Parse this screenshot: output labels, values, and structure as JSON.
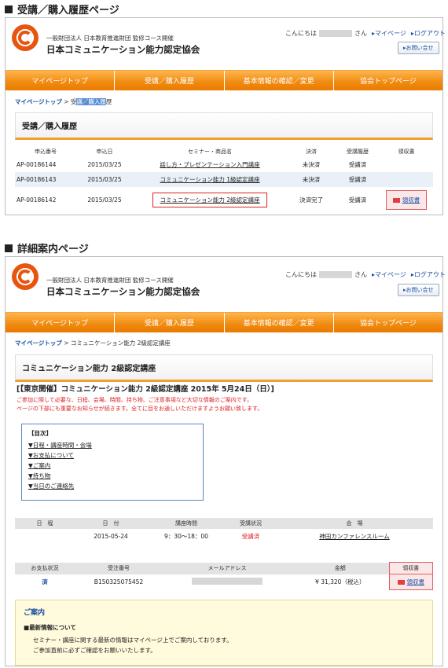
{
  "section1_title": "受講／購入履歴ページ",
  "section2_title": "詳細案内ページ",
  "header": {
    "org_small": "一般財団法人 日本教育推進財団 監修コース開催",
    "org_large": "日本コミュニケーション能力認定協会",
    "greeting_pre": "こんにちは",
    "greeting_post": "さん",
    "mypage_link": "▸マイページ",
    "logout_link": "▸ログアウト",
    "inquiry_button": "▸お問い合せ"
  },
  "nav": [
    "マイページトップ",
    "受講／購入履歴",
    "基本情報の確認／変更",
    "協会トップページ"
  ],
  "page1": {
    "crumb_home": "マイページトップ",
    "crumb_sep": " > ",
    "crumb_cur_a": "受",
    "crumb_cur_b": "講／購入履",
    "crumb_cur_c": "歴",
    "title": "受講／購入履歴",
    "columns": [
      "申込番号",
      "申込日",
      "セミナー・商品名",
      "決済",
      "受講履歴",
      "領収書"
    ],
    "rows": [
      {
        "no": "AP-00186144",
        "date": "2015/03/25",
        "name": "話し方・プレゼンテーション入門講座",
        "pay": "未決済",
        "status": "受講済",
        "receipt": ""
      },
      {
        "no": "AP-00186143",
        "date": "2015/03/25",
        "name": "コミュニケーション能力 1級認定講座",
        "pay": "未決済",
        "status": "受講済",
        "receipt": ""
      },
      {
        "no": "AP-00186142",
        "date": "2015/03/25",
        "name": "コミュニケーション能力 2級認定講座",
        "pay": "決済完了",
        "status": "受講済",
        "receipt": "領収書"
      }
    ]
  },
  "page2": {
    "crumb_home": "マイページトップ",
    "crumb_sep": " > ",
    "crumb_cur": "コミュニケーション能力 2級認定講座",
    "title": "コミュニケーション能力 2級認定講座",
    "event_title": "[【東京開催】コミュニケーション能力 2級認定講座 2015年 5月24日（日）]",
    "notice1": "ご参加に際して必要な、日程、会場、時間、持ち物、ご注意事項など大切な情報のご案内です。",
    "notice2": "ページの下部にも重要なお知らせが続きます。全てに目をお通しいただけますようお願い致します。",
    "toc_title": "【目次】",
    "toc": [
      "▼日程・講座時間・会場",
      "▼お支払について",
      "▼ご案内",
      "▼持ち物",
      "▼当日のご連絡先"
    ],
    "sched_headers": [
      "日　程",
      "日　付",
      "講座時間",
      "受講状況",
      "会　場"
    ],
    "sched": {
      "date": "2015-05-24",
      "time": "9：30～18：00",
      "status": "受講済",
      "venue": "神田カンファレンスルーム"
    },
    "pay_headers": [
      "お支払状況",
      "受注番号",
      "メールアドレス",
      "金額",
      "領収書"
    ],
    "pay": {
      "state": "済",
      "order": "B150325075452",
      "amount": "¥ 31,320（税込）",
      "receipt": "領収書"
    },
    "guide_title": "ご案内",
    "guide_sub": "■最新情報について",
    "guide1": "セミナー・講座に関する最新の情報はマイページ上でご案内しております。",
    "guide2": "ご参加直前に必ずご確認をお願いいたします。"
  }
}
